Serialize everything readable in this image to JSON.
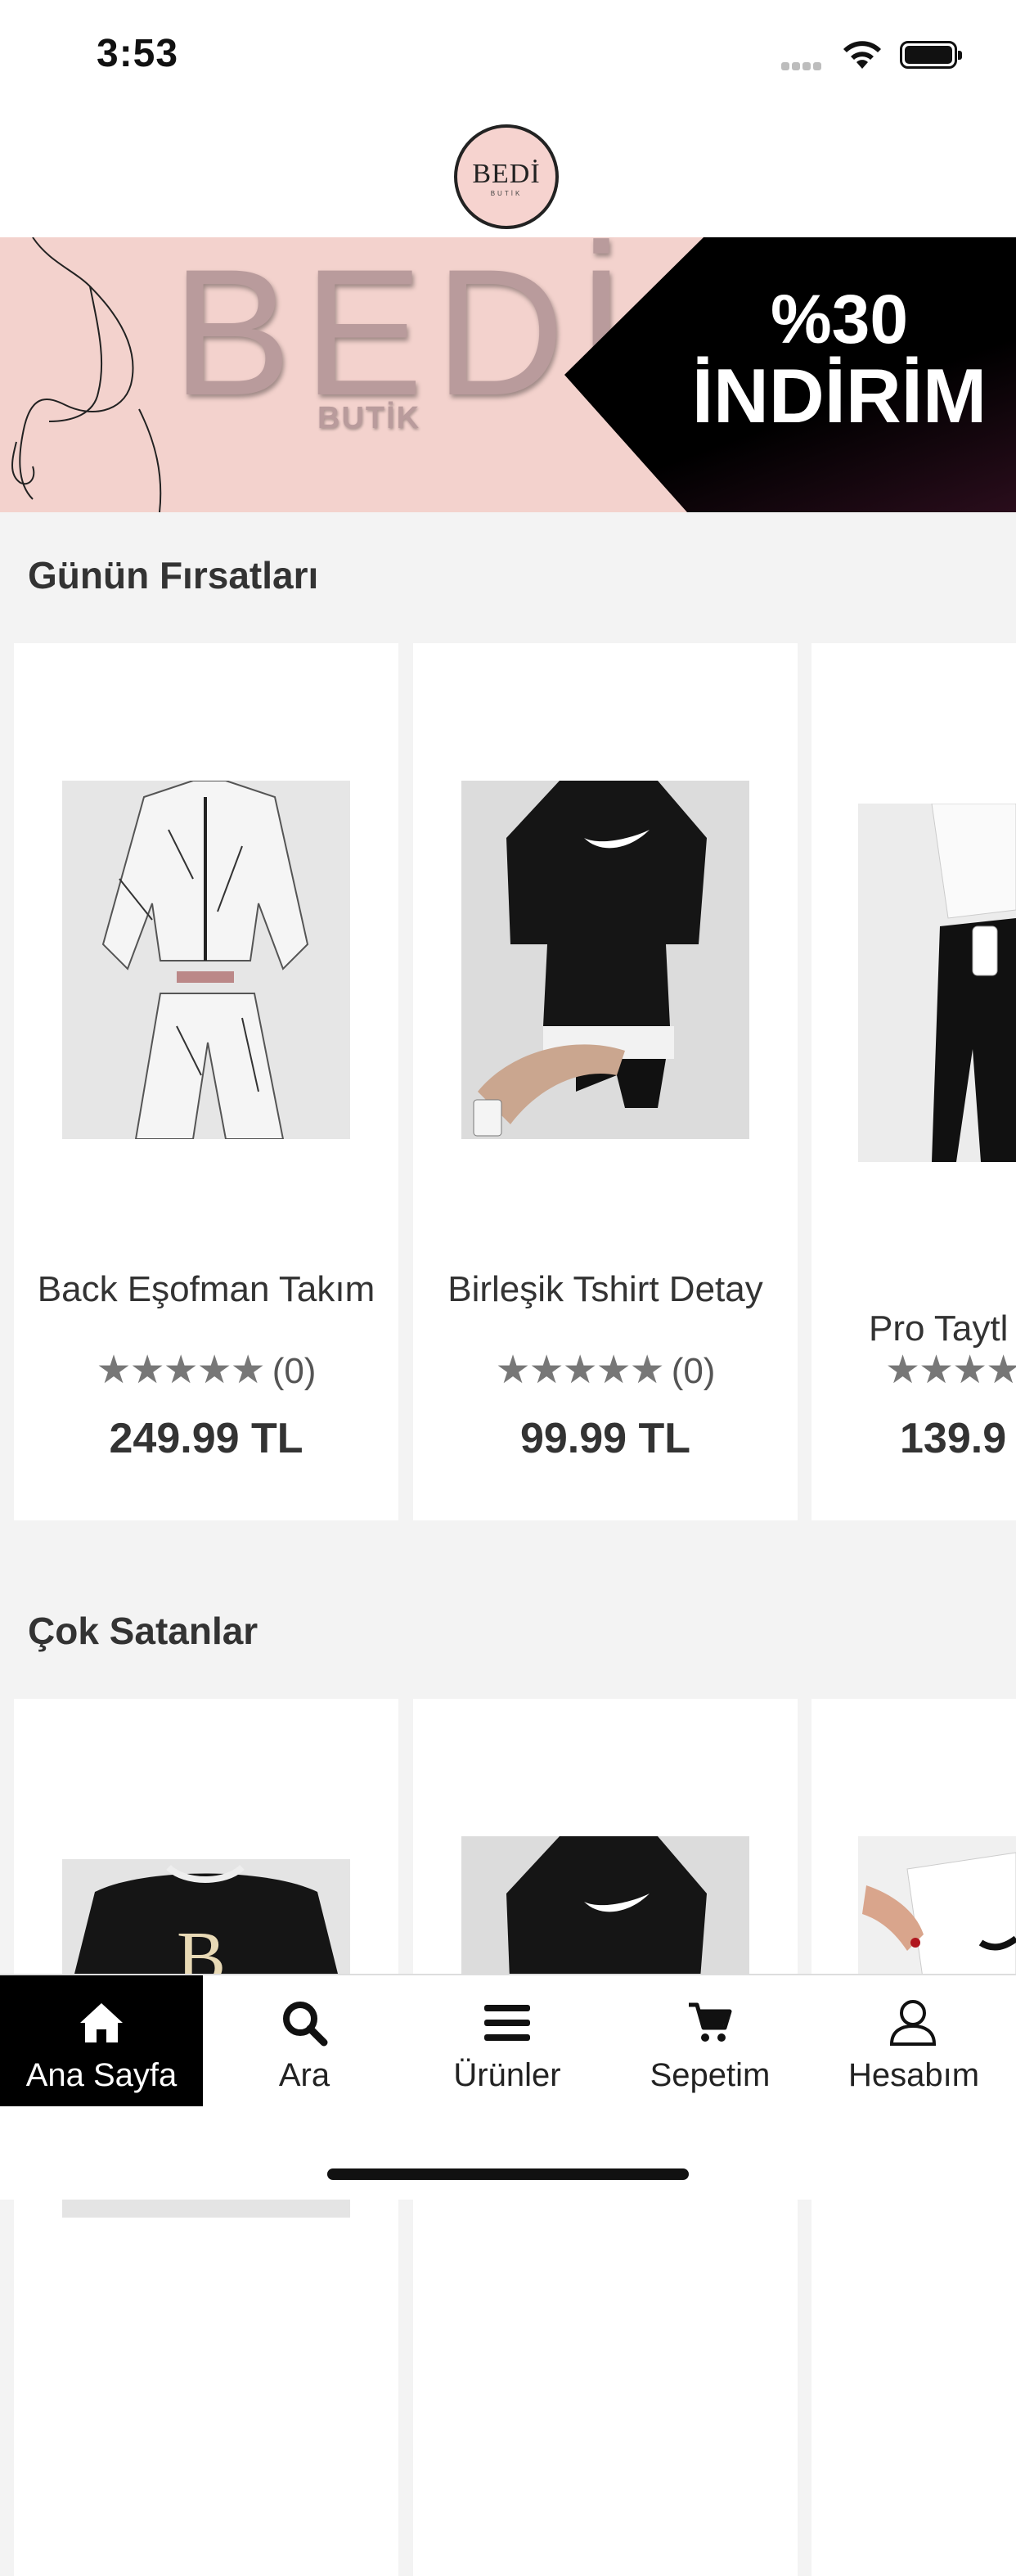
{
  "status": {
    "time": "3:53"
  },
  "header": {
    "logo_text": "BEDİ",
    "logo_sub": "BUTİK"
  },
  "banner": {
    "title": "BEDİ",
    "subtitle": "BUTİK",
    "promo_line1": "%30",
    "promo_line2": "İNDİRİM"
  },
  "sections": [
    {
      "title": "Günün Fırsatları",
      "products": [
        {
          "name": "Back Eşofman Takım",
          "stars": "★★★★★",
          "count": "(0)",
          "price": "249.99 TL"
        },
        {
          "name": "Birleşik Tshirt Detay",
          "stars": "★★★★★",
          "count": "(0)",
          "price": "99.99 TL"
        },
        {
          "name": "Pro Taytl",
          "stars": "★★★★",
          "count": "",
          "price": "139.9"
        }
      ]
    },
    {
      "title": "Çok Satanlar",
      "products": [
        {
          "name": "",
          "price": ""
        },
        {
          "name": "",
          "price": ""
        },
        {
          "name": "",
          "price": ""
        }
      ]
    }
  ],
  "tabs": [
    {
      "label": "Ana Sayfa",
      "icon": "home-icon"
    },
    {
      "label": "Ara",
      "icon": "search-icon"
    },
    {
      "label": "Ürünler",
      "icon": "menu-icon"
    },
    {
      "label": "Sepetim",
      "icon": "cart-icon"
    },
    {
      "label": "Hesabım",
      "icon": "user-icon"
    }
  ],
  "colors": {
    "accent": "#000000",
    "banner_bg": "#f3d2cd",
    "page_bg": "#f3f3f3"
  }
}
